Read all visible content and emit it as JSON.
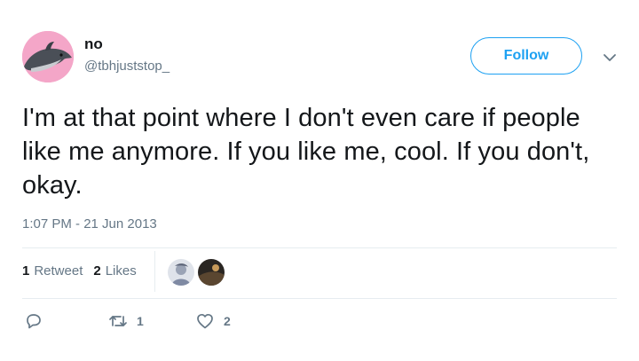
{
  "user": {
    "display_name": "no",
    "handle": "@tbhjuststop_",
    "avatar_icon": "dolphin-avatar"
  },
  "follow_button": {
    "label": "Follow"
  },
  "menu": {
    "icon": "chevron-down-icon"
  },
  "tweet": {
    "text": "I'm at that point where I don't even care if people like me anymore. If you like me, cool. If you don't, okay.",
    "timestamp": "1:07 PM - 21 Jun 2013"
  },
  "stats": {
    "retweets_count": "1",
    "retweets_label": "Retweet",
    "likes_count": "2",
    "likes_label": "Likes"
  },
  "actions": {
    "reply": {
      "icon": "reply-icon",
      "count": ""
    },
    "retweet": {
      "icon": "retweet-icon",
      "count": "1"
    },
    "like": {
      "icon": "heart-icon",
      "count": "2"
    }
  },
  "colors": {
    "accent": "#1da1f2",
    "secondary_text": "#657786",
    "avatar_bg": "#f4a6c8"
  }
}
